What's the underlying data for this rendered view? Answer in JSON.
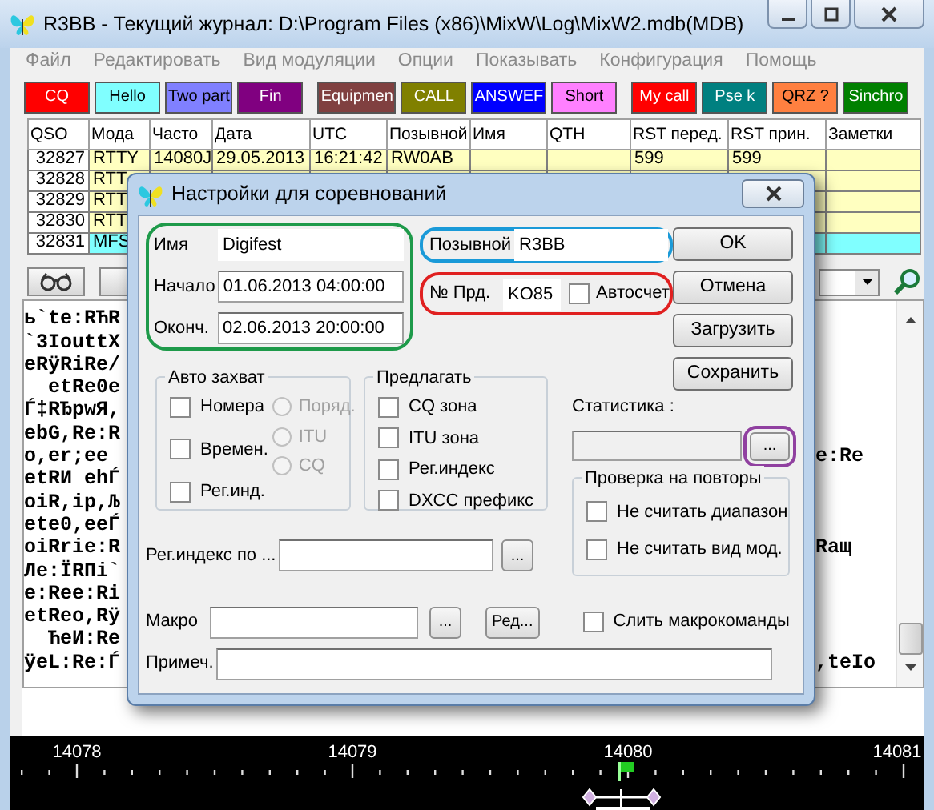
{
  "window": {
    "title": "R3BB - Текущий журнал: D:\\Program Files (x86)\\MixW\\Log\\MixW2.mdb(MDB)"
  },
  "menu": [
    "Файл",
    "Редактировать",
    "Вид модуляции",
    "Опции",
    "Показывать",
    "Конфигурация",
    "Помощь"
  ],
  "macro_buttons": [
    {
      "label": "CQ",
      "color": "#ff0000"
    },
    {
      "label": "Hello",
      "color": "#80ffff"
    },
    {
      "label": "Two part",
      "color": "#8080ff"
    },
    {
      "label": "Fin",
      "color": "#800080"
    },
    {
      "label": "Equipmen",
      "color": "#804040"
    },
    {
      "label": "CALL",
      "color": "#808000"
    },
    {
      "label": "ANSWEF",
      "color": "#0000ff"
    },
    {
      "label": "Short",
      "color": "#ff80ff"
    },
    {
      "label": "My call",
      "color": "#ff0000"
    },
    {
      "label": "Pse k",
      "color": "#008080"
    },
    {
      "label": "QRZ ?",
      "color": "#ff8040"
    },
    {
      "label": "Sinchro",
      "color": "#008000"
    }
  ],
  "log_table": {
    "columns": [
      "QSO",
      "Мода",
      "Часто",
      "Дата",
      "UTC",
      "Позывной",
      "Имя",
      "QTH",
      "RST перед.",
      "RST прин.",
      "Заметки"
    ],
    "rows": [
      {
        "cells": [
          "32827",
          "RTTY",
          "14080J",
          "29.05.2013",
          "16:21:42",
          "RW0AB",
          null,
          null,
          "599",
          "599"
        ],
        "selected": false
      },
      {
        "cells": [
          "32828",
          "RTT"
        ],
        "selected": false
      },
      {
        "cells": [
          "32829",
          "RTT"
        ],
        "selected": false
      },
      {
        "cells": [
          "32830",
          "RTT"
        ],
        "selected": false
      },
      {
        "cells": [
          "32831",
          "MFS"
        ],
        "selected": true
      }
    ]
  },
  "terminal_lines": [
    {
      "left": "ь`te:RЋR"
    },
    {
      "left": "`3IouttX"
    },
    {
      "left": "eRÿRiRe/"
    },
    {
      "left": "  etRe0e"
    },
    {
      "left": "Ѓ‡RЂрwЯ,"
    },
    {
      "left": "ebG,Re:R"
    },
    {
      "left": "o,er;ee",
      "right": "e:Re"
    },
    {
      "left": "etRИ ehЃ"
    },
    {
      "left": "oiR,ip,Љ"
    },
    {
      "left": "ete0,eeЃ"
    },
    {
      "left": "oiRrie:R",
      "right": "Raщ"
    },
    {
      "left": "Ле:ЇRПi`"
    },
    {
      "left": "e:Ree:Ri"
    },
    {
      "left": "etReo,Rÿ"
    },
    {
      "left": "  ЋeИ:Re"
    },
    {
      "left": "ÿeL:Re:Ѓ",
      "right": ",teIo"
    }
  ],
  "frequency_scale": {
    "labels": [
      "14078",
      "14079",
      "14080",
      "14081"
    ]
  },
  "dialog": {
    "title": "Настройки для соревнований",
    "name": {
      "label": "Имя",
      "value": "Digifest"
    },
    "start": {
      "label": "Начало",
      "value": "01.06.2013 04:00:00"
    },
    "end": {
      "label": "Оконч.",
      "value": "02.06.2013 20:00:00"
    },
    "callsign": {
      "label": "Позывной",
      "value": "R3BB"
    },
    "serial": {
      "label": "№ Прд.",
      "value": "KO85"
    },
    "autocount": {
      "label": "Автосчет",
      "checked": false
    },
    "buttons": [
      "OK",
      "Отмена",
      "Загрузить",
      "Сохранить"
    ],
    "auto_capture": {
      "title": "Авто захват",
      "checkboxes": [
        {
          "label": "Номера",
          "checked": false
        },
        {
          "label": "Времен.",
          "checked": false
        },
        {
          "label": "Рег.инд.",
          "checked": false
        }
      ],
      "radios": [
        {
          "label": "Поряд.",
          "selected": false,
          "disabled": true
        },
        {
          "label": "ITU",
          "selected": false,
          "disabled": true
        },
        {
          "label": "CQ",
          "selected": false,
          "disabled": true
        }
      ]
    },
    "suggest": {
      "title": "Предлагать",
      "checkboxes": [
        {
          "label": "CQ зона",
          "checked": false
        },
        {
          "label": "ITU зона",
          "checked": false
        },
        {
          "label": "Рег.индекс",
          "checked": false
        },
        {
          "label": "DXCC префикс",
          "checked": false
        }
      ]
    },
    "statistics": {
      "label": "Статистика :",
      "disabled": true,
      "browse": "..."
    },
    "dup_check": {
      "title": "Проверка на повторы",
      "checkboxes": [
        {
          "label": "Не считать диапазон",
          "checked": false
        },
        {
          "label": "Не считать вид мод.",
          "checked": false
        }
      ]
    },
    "region_index": {
      "label": "Рег.индекс по ...",
      "browse": "..."
    },
    "macro": {
      "label": "Макро",
      "browse": "...",
      "edit": "Ред..."
    },
    "merge_macros": {
      "label": "Слить макрокоманды",
      "checked": false
    },
    "note": {
      "label": "Примеч."
    }
  }
}
